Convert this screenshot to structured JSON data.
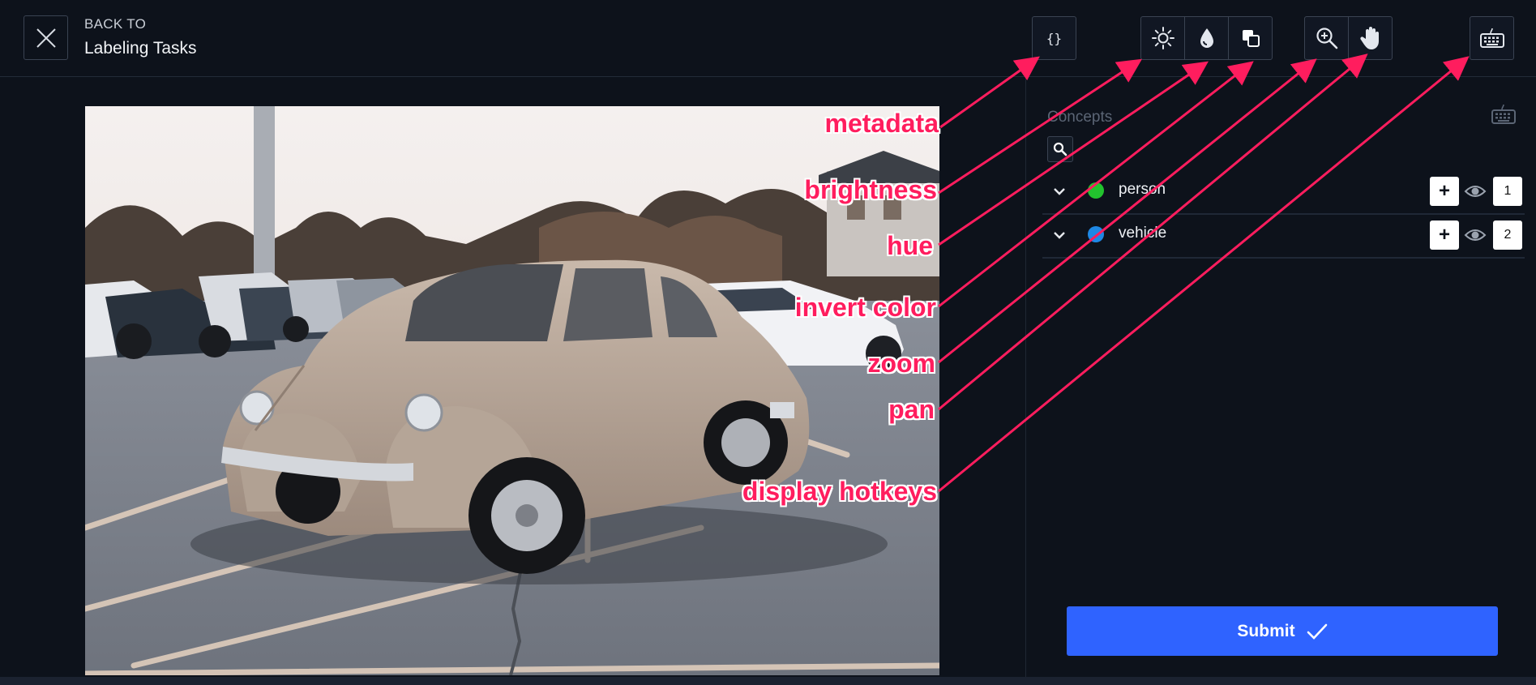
{
  "header": {
    "back_label": "BACK TO",
    "title": "Labeling Tasks",
    "tools": {
      "metadata_glyph": "{}",
      "icons": [
        "brightness-icon",
        "hue-icon",
        "invert-color-icon",
        "zoom-icon",
        "pan-icon",
        "keyboard-icon"
      ]
    }
  },
  "panel": {
    "concepts_title": "Concepts",
    "concepts": [
      {
        "name": "person",
        "color": "#22c32e",
        "count": "1"
      },
      {
        "name": "vehicle",
        "color": "#1e88e5",
        "count": "2"
      }
    ],
    "submit_label": "Submit"
  },
  "annotations": {
    "metadata": "metadata",
    "brightness": "brightness",
    "hue": "hue",
    "invert_color": "invert color",
    "zoom": "zoom",
    "pan": "pan",
    "display_hotkeys": "display hotkeys"
  },
  "colors": {
    "background": "#0d121b",
    "accent": "#2f63ff",
    "annotation": "#ff1d5e"
  }
}
